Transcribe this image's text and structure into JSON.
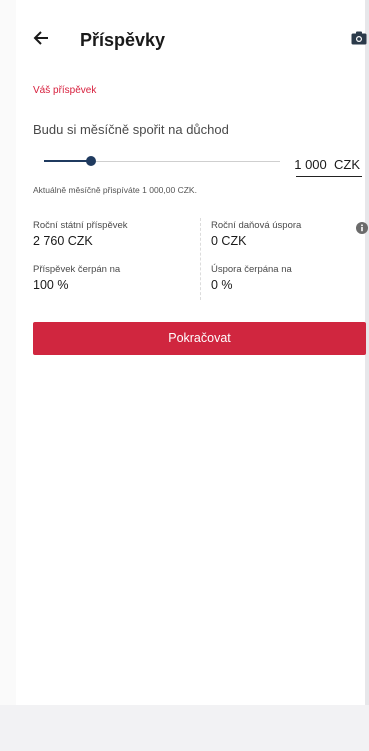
{
  "header": {
    "title": "Příspěvky",
    "back_icon": "arrow-left-icon",
    "camera_icon": "camera-icon"
  },
  "contribution": {
    "section_title": "Váš příspěvek",
    "prompt": "Budu si měsíčně spořit na důchod",
    "slider_level": 0.2,
    "amount": "1 000  CZK",
    "current_info": "Aktuálně měsíčně přispíváte 1 000,00 CZK."
  },
  "details": {
    "state_label": "Roční státní příspěvek",
    "state_value": "2 760 CZK",
    "tax_label": "Roční daňová úspora",
    "tax_value": "0 CZK",
    "used_label": "Příspěvek čerpán na",
    "used_value": "100 %",
    "saving_label": "Úspora čerpána na",
    "saving_value": "0 %",
    "info_icon": "info-icon"
  },
  "actions": {
    "continue_label": "Pokračovat"
  },
  "colors": {
    "accent": "#d0263f",
    "section_title": "#d71e3c",
    "slider": "#1f3a5f"
  }
}
